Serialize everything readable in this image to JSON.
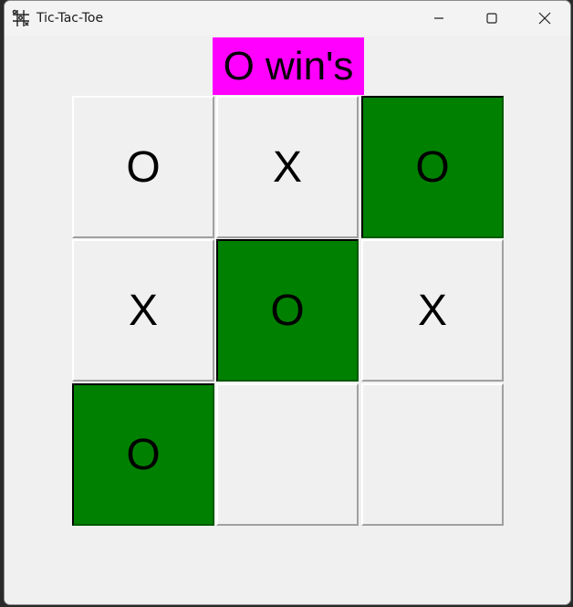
{
  "window": {
    "title": "Tic-Tac-Toe",
    "icon": "hash-grid-icon"
  },
  "status": {
    "text": "O win's",
    "background": "#ff00ff"
  },
  "colors": {
    "win_cell": "#008000",
    "cell": "#f0f0f0"
  },
  "board": {
    "cells": [
      {
        "mark": "O",
        "winning": false
      },
      {
        "mark": "X",
        "winning": false
      },
      {
        "mark": "O",
        "winning": true
      },
      {
        "mark": "X",
        "winning": false
      },
      {
        "mark": "O",
        "winning": true
      },
      {
        "mark": "X",
        "winning": false
      },
      {
        "mark": "O",
        "winning": true
      },
      {
        "mark": "",
        "winning": false
      },
      {
        "mark": "",
        "winning": false
      }
    ]
  }
}
